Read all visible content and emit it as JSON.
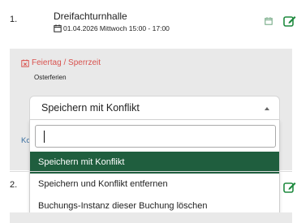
{
  "bookings": [
    {
      "number": "1.",
      "title": "Dreifachturnhalle",
      "datetime": "01.04.2026 Mittwoch 15:00 - 17:00"
    },
    {
      "number": "2."
    }
  ],
  "conflict": {
    "heading": "Feiertag / Sperrzeit",
    "reason": "Osterferien",
    "link_fragment": "Ko"
  },
  "select": {
    "current_value": "Speichern mit Konflikt",
    "search_value": "",
    "options": [
      {
        "label": "Speichern mit Konflikt",
        "selected": true
      },
      {
        "label": "Speichern und Konflikt entfernen",
        "selected": false
      },
      {
        "label": "Buchungs-Instanz dieser Buchung löschen",
        "selected": false
      }
    ]
  },
  "icons": {
    "calendar": "calendar-icon",
    "edit": "edit-icon",
    "conflict": "calendar-x-icon"
  },
  "colors": {
    "accent_green": "#1f8a3f",
    "selected_option_bg": "#1f5e3e",
    "conflict_red": "#d9534f",
    "panel_bg": "#e9e9e9"
  }
}
